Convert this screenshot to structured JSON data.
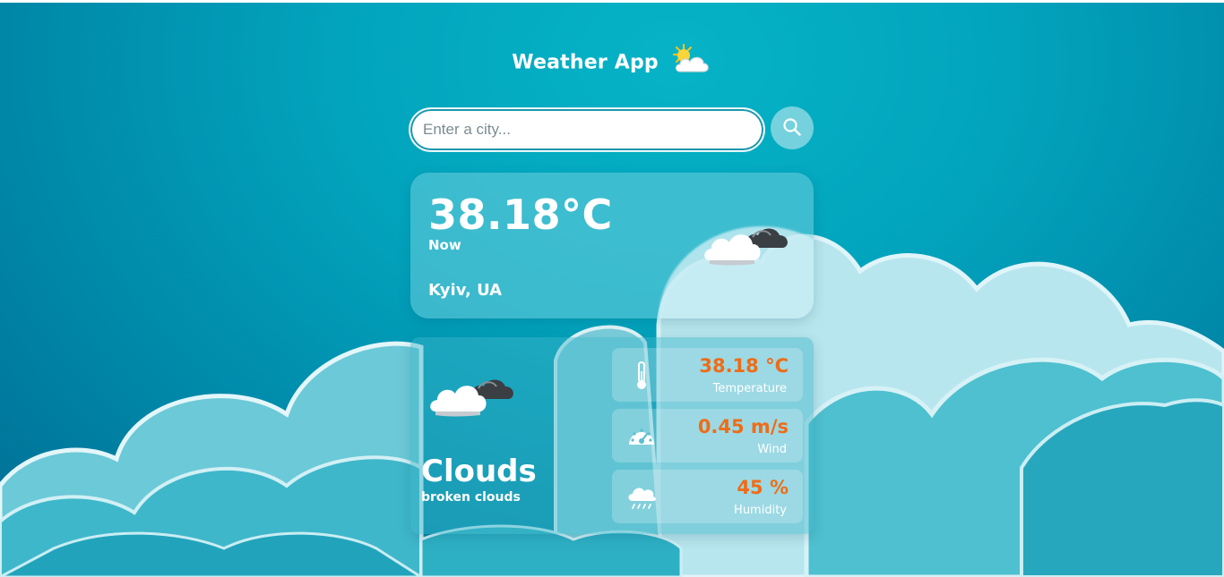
{
  "app": {
    "title": "Weather App",
    "logo_icon": "sun-behind-cloud-icon"
  },
  "search": {
    "placeholder": "Enter a city...",
    "value": "",
    "button_icon": "search-icon"
  },
  "current": {
    "temperature": "38.18°C",
    "time_label": "Now",
    "location": "Kyiv, UA",
    "icon": "broken-clouds-icon"
  },
  "details": {
    "icon": "broken-clouds-icon",
    "condition": "Clouds",
    "description": "broken clouds",
    "stats": [
      {
        "icon": "thermometer-icon",
        "value": "38.18 °C",
        "label": "Temperature"
      },
      {
        "icon": "speedometer-icon",
        "value": "0.45 m/s",
        "label": "Wind"
      },
      {
        "icon": "rain-cloud-icon",
        "value": "45 %",
        "label": "Humidity"
      }
    ]
  },
  "colors": {
    "accent_value": "#ef6c17",
    "background": "#02a4bd",
    "text": "#ffffff"
  }
}
